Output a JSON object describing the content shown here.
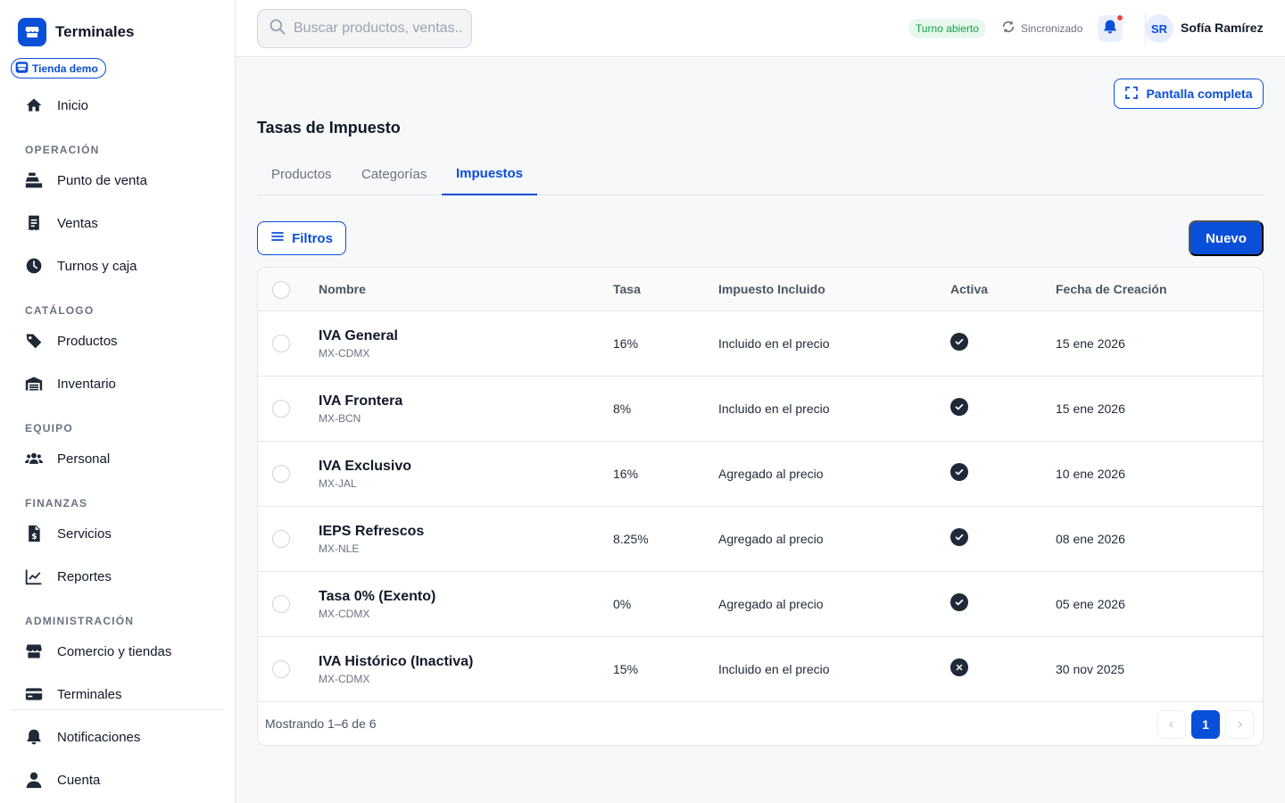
{
  "app": {
    "name": "Terminales",
    "store": "Tienda demo"
  },
  "sidebar": {
    "home": "Inicio",
    "sections": [
      {
        "title": "OPERACIÓN",
        "items": [
          "Punto de venta",
          "Ventas",
          "Turnos y caja"
        ]
      },
      {
        "title": "CATÁLOGO",
        "items": [
          "Productos",
          "Inventario"
        ]
      },
      {
        "title": "EQUIPO",
        "items": [
          "Personal"
        ]
      },
      {
        "title": "FINANZAS",
        "items": [
          "Servicios",
          "Reportes"
        ]
      },
      {
        "title": "ADMINISTRACIÓN",
        "items": [
          "Comercio y tiendas",
          "Terminales"
        ]
      }
    ],
    "bottom": [
      "Notificaciones",
      "Cuenta"
    ]
  },
  "topbar": {
    "search_placeholder": "Buscar productos, ventas...",
    "shift_status": "Turno abierto",
    "sync_status": "Sincronizado",
    "user_initials": "SR",
    "user_name": "Sofía Ramírez"
  },
  "page": {
    "fullscreen_label": "Pantalla completa",
    "title": "Tasas de Impuesto",
    "tabs": [
      "Productos",
      "Categorías",
      "Impuestos"
    ],
    "active_tab": "Impuestos",
    "filters_label": "Filtros",
    "new_label": "Nuevo"
  },
  "table": {
    "columns": [
      "Nombre",
      "Tasa",
      "Impuesto Incluido",
      "Activa",
      "Fecha de Creación"
    ],
    "rows": [
      {
        "name": "IVA General",
        "code": "MX-CDMX",
        "rate": "16%",
        "included": "Incluido en el precio",
        "active": true,
        "created": "15 ene 2026"
      },
      {
        "name": "IVA Frontera",
        "code": "MX-BCN",
        "rate": "8%",
        "included": "Incluido en el precio",
        "active": true,
        "created": "15 ene 2026"
      },
      {
        "name": "IVA Exclusivo",
        "code": "MX-JAL",
        "rate": "16%",
        "included": "Agregado al precio",
        "active": true,
        "created": "10 ene 2026"
      },
      {
        "name": "IEPS Refrescos",
        "code": "MX-NLE",
        "rate": "8.25%",
        "included": "Agregado al precio",
        "active": true,
        "created": "08 ene 2026"
      },
      {
        "name": "Tasa 0% (Exento)",
        "code": "MX-CDMX",
        "rate": "0%",
        "included": "Agregado al precio",
        "active": true,
        "created": "05 ene 2026"
      },
      {
        "name": "IVA Histórico (Inactiva)",
        "code": "MX-CDMX",
        "rate": "15%",
        "included": "Incluido en el precio",
        "active": false,
        "created": "30 nov 2025"
      }
    ],
    "footer": "Mostrando 1–6 de 6",
    "current_page": "1"
  },
  "colors": {
    "accent": "#0a4fd8",
    "success": "#16a34a",
    "alert": "#ef4444"
  }
}
